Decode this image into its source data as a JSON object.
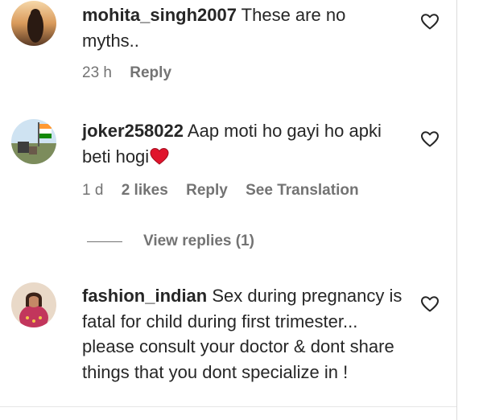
{
  "comments": [
    {
      "username": "mohita_singh2007",
      "text": "These are no myths..",
      "time": "23 h",
      "reply_label": "Reply"
    },
    {
      "username": "joker258022",
      "text": "Aap moti ho gayi ho apki beti hogi",
      "emoji": "heart-emoji",
      "time": "1 d",
      "likes": "2 likes",
      "reply_label": "Reply",
      "translation_label": "See Translation",
      "view_replies_label": "View replies (1)"
    },
    {
      "username": "fashion_indian",
      "text": "Sex during pregnancy is fatal for child during first trimester... please consult your doctor & dont share things that you dont specialize in !"
    }
  ],
  "colors": {
    "text": "#262626",
    "secondary": "#737373",
    "heart": "#ed2843"
  }
}
